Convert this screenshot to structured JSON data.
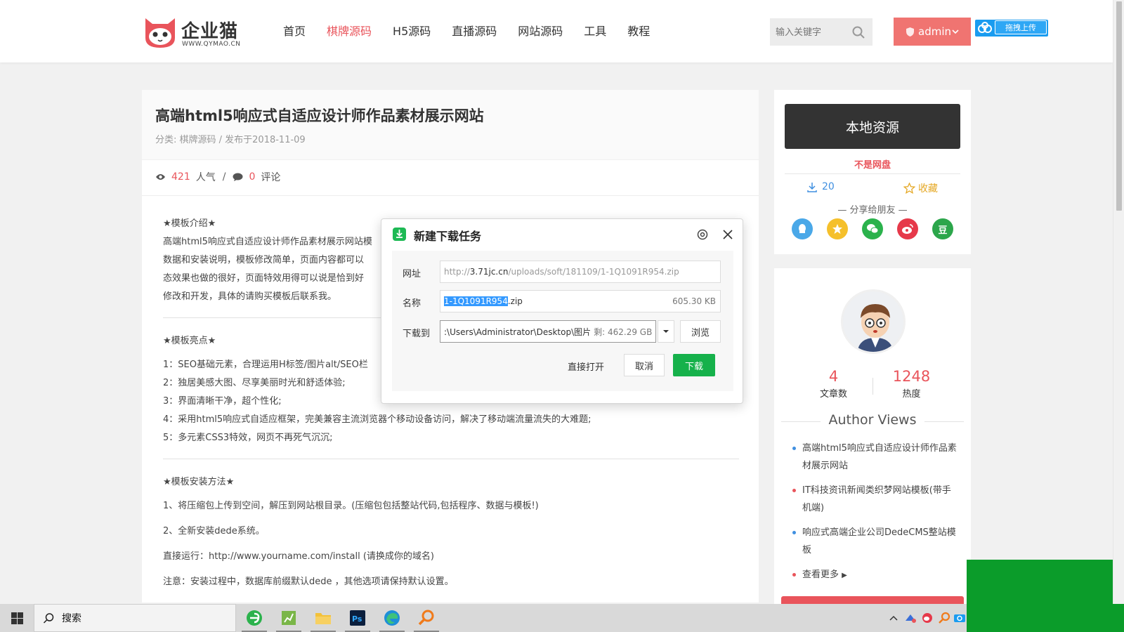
{
  "header": {
    "logo_text": "企业猫",
    "logo_url": "WWW.QYMAO.CN",
    "nav": [
      "首页",
      "棋牌源码",
      "H5源码",
      "直播源码",
      "网站源码",
      "工具",
      "教程"
    ],
    "active_nav": "棋牌源码",
    "search_placeholder": "输入关键字",
    "admin_label": "admin",
    "upload_label": "拖拽上传"
  },
  "article": {
    "title": "高端html5响应式自适应设计师作品素材展示网站",
    "meta": "分类: 棋牌源码 / 发布于2018-11-09",
    "views": "421",
    "views_label": "人气",
    "comments": "0",
    "comments_label": "评论",
    "intro_heading": "★模板介绍★",
    "intro_lines": [
      "高端html5响应式自适应设计师作品素材展示网站模",
      "数据和安装说明，模板修改简单，页面内容都可以",
      "态效果也做的很好，页面特效用得可以说是恰到好",
      "修改和开发，具体的请购买模板后联系我。"
    ],
    "highlights_heading": "★模板亮点★",
    "highlights": [
      "1：SEO基础元素，合理运用H标签/图片alt/SEO栏",
      "2：独居美感大图、尽享美丽时光和舒适体验;",
      "3：界面清晰干净，超个性化;",
      "4：采用html5响应式自适应框架，完美兼容主流浏览器个移动设备访问，解决了移动端流量流失的大难题;",
      "5：多元素CSS3特效，网页不再死气沉沉;"
    ],
    "install_heading": "★模板安装方法★",
    "install_lines": [
      "1、将压缩包上传到空间，解压到网站根目录。(压缩包包括整站代码,包括程序、数据与模板!)",
      "2、全新安装dede系统。",
      "直接运行：http://www.yourname.com/install (请换成你的域名)",
      "注意：安装过程中，数据库前缀默认dede ，其他选项请保持默认设置。"
    ]
  },
  "sidebar": {
    "local_label": "本地资源",
    "not_disk": "不是网盘",
    "downloads": "20",
    "favorite_label": "收藏",
    "share_title": "— 分享给朋友 —",
    "share_icons": [
      "qq-icon",
      "qzone-icon",
      "wechat-icon",
      "weibo-icon",
      "douban-icon"
    ],
    "douban_char": "豆",
    "articles_count": "4",
    "articles_label": "文章数",
    "heat": "1248",
    "heat_label": "热度",
    "author_views_title": "Author Views",
    "author_list": [
      "高端html5响应式自适应设计师作品素材展示网站",
      "IT科技资讯新闻类织梦网站模板(带手机端)",
      "响应式高端企业公司DedeCMS整站模板",
      "查看更多"
    ]
  },
  "dialog": {
    "title": "新建下载任务",
    "url_label": "网址",
    "url_prefix": "http://",
    "url_host": "3.71jc.cn",
    "url_path": "/uploads/soft/181109/1-1Q1091R954.zip",
    "name_label": "名称",
    "name_selected": "1-1Q1091R954",
    "name_ext": ".zip",
    "file_size": "605.30 KB",
    "save_label": "下载到",
    "save_path": ":\\Users\\Administrator\\Desktop\\图片",
    "free_space": "剩: 462.29 GB",
    "browse_label": "浏览",
    "open_label": "直接打开",
    "cancel_label": "取消",
    "download_label": "下载"
  },
  "taskbar": {
    "search_label": "搜索"
  },
  "colors": {
    "accent_red": "#e9545b",
    "download_green": "#16b14b",
    "link_blue": "#3f8fe0"
  }
}
